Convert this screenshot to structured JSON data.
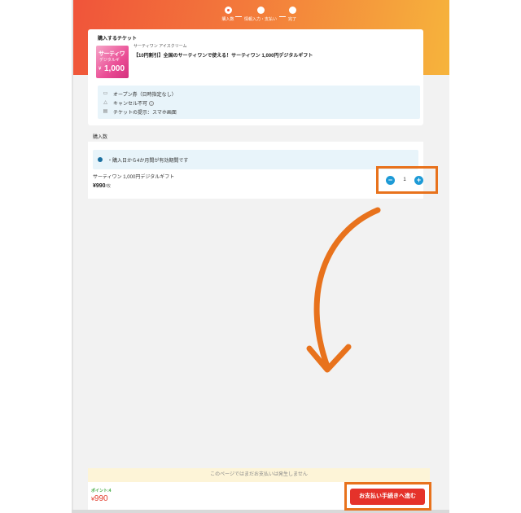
{
  "stepper": {
    "steps": [
      {
        "label": "購入数"
      },
      {
        "label": "情報入力・支払い"
      },
      {
        "label": "完了"
      }
    ]
  },
  "ticket": {
    "section_title": "購入するチケット",
    "brand": "サーティワン アイスクリーム",
    "product_name": "【10円割引】全国のサーティワンで使える！サーティワン 1,000円デジタルギフト",
    "thumbnail": {
      "line1": "サーティワ",
      "line2": "デジタルギ",
      "yen": "¥",
      "amount": "1,000"
    },
    "info": [
      {
        "icon": "calendar-icon",
        "text": "オープン券（日時指定なし）"
      },
      {
        "icon": "warning-icon",
        "text": "キャンセル不可"
      },
      {
        "icon": "document-icon",
        "text": "チケットの提示：スマホ画面"
      }
    ]
  },
  "quantity": {
    "section_title": "購入数",
    "notice": "・購入日から4か月間が有効期間です",
    "item_name": "サーティワン 1,000円デジタルギフト",
    "price": "¥990",
    "price_unit": "/枚",
    "value": "1",
    "minus": "−",
    "plus": "+"
  },
  "footer": {
    "notice": "このページではまだお支払いは発生しません",
    "points": "ポイント:4",
    "total_yen": "¥",
    "total": "990",
    "pay_button": "お支払い手続きへ進む"
  },
  "colors": {
    "accent_orange": "#e8721c",
    "pay_red": "#e5322a",
    "stepper_blue": "#1d9ad6"
  }
}
